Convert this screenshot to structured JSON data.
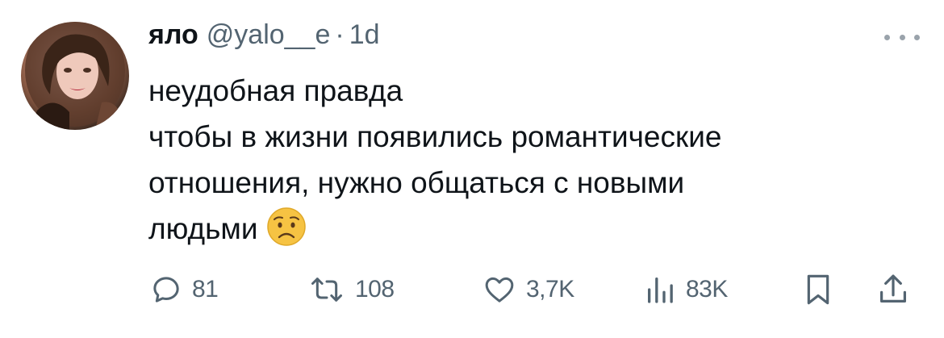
{
  "tweet": {
    "author_name": "яло",
    "handle": "@yalo__e",
    "separator": "·",
    "time": "1d",
    "lines": [
      "неудобная правда",
      "чтобы в жизни появились романтические",
      "отношения, нужно общаться с новыми",
      "людьми"
    ],
    "emoji": "worried-face"
  },
  "actions": {
    "replies": "81",
    "reposts": "108",
    "likes": "3,7K",
    "views": "83K"
  },
  "colors": {
    "text": "#0f1419",
    "muted": "#536471",
    "emoji_face": "#f6c343"
  },
  "icons": [
    "reply-icon",
    "repost-icon",
    "like-icon",
    "views-icon",
    "bookmark-icon",
    "share-icon",
    "more-icon"
  ]
}
